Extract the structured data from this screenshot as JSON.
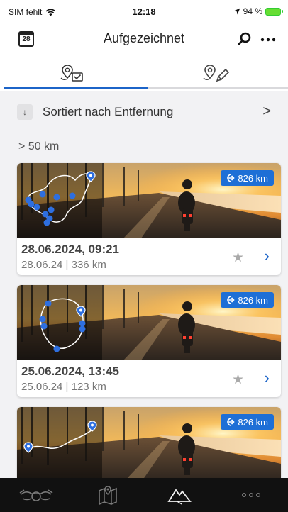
{
  "status": {
    "carrier": "SIM fehlt",
    "time": "12:18",
    "battery": "94 %"
  },
  "nav": {
    "calendar_day": "28",
    "title": "Aufgezeichnet"
  },
  "tabs": {
    "active": 0,
    "icons": [
      "recorded-routes-icon",
      "planned-routes-icon"
    ]
  },
  "sort": {
    "label": "Sortiert nach Entfernung",
    "chevron": ">"
  },
  "section": {
    "header": "> 50 km"
  },
  "rides": [
    {
      "title": "28.06.2024, 09:21",
      "subtitle": "28.06.24 | 336 km",
      "distance_badge": "826 km"
    },
    {
      "title": "25.06.2024, 13:45",
      "subtitle": "25.06.24 | 123 km",
      "distance_badge": "826 km"
    },
    {
      "distance_badge": "826 km"
    }
  ],
  "bottom_tabs": [
    "motorcycle-icon",
    "map-icon",
    "rides-mountain-icon",
    "more-icon"
  ],
  "colors": {
    "accent": "#1c64c8",
    "badge": "#1e6fd6",
    "tabbar": "#111111"
  }
}
